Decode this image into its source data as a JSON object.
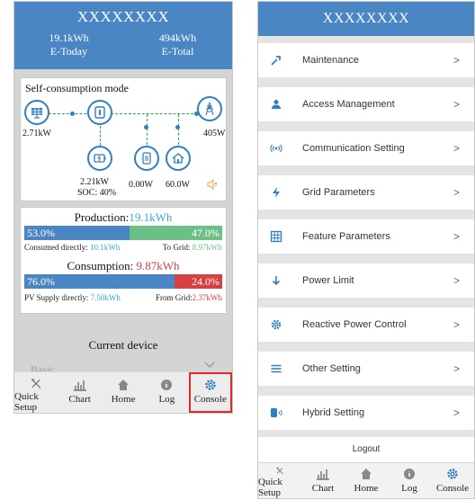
{
  "left": {
    "title": "XXXXXXXX",
    "today_value": "19.1kWh",
    "today_label": "E-Today",
    "total_value": "494kWh",
    "total_label": "E-Total",
    "mode": "Self-consumption mode",
    "pv_power": "2.71kW",
    "grid_power": "405W",
    "battery_power": "2.21kW",
    "battery_soc": "SOC: 40%",
    "meter_power": "0.00W",
    "load_power": "60.0W",
    "production": {
      "title": "Production:",
      "value": "19.1kWh",
      "left_pct": "53.0%",
      "right_pct": "47.0%",
      "left_fraction": 0.53,
      "consumed_label": "Consumed directly:",
      "consumed_value": "10.1kWh",
      "togrid_label": "To Grid:",
      "togrid_value": "8.97kWh"
    },
    "consumption": {
      "title": "Consumption:",
      "value": "9.87kWh",
      "left_pct": "76.0%",
      "right_pct": "24.0%",
      "left_fraction": 0.76,
      "pv_label": "PV Supply directly:",
      "pv_value": "7.50kWh",
      "grid_label": "From Grid:",
      "grid_value": "2.37kWh"
    },
    "current_device": "Current device",
    "basic": "Basic"
  },
  "tabs": [
    "Quick Setup",
    "Chart",
    "Home",
    "Log",
    "Console"
  ],
  "right": {
    "title": "XXXXXXXX",
    "menu": [
      {
        "label": "Maintenance",
        "icon": "wrench-icon"
      },
      {
        "label": "Access Management",
        "icon": "user-icon"
      },
      {
        "label": "Communication Setting",
        "icon": "signal-icon"
      },
      {
        "label": "Grid Parameters",
        "icon": "lightning-icon"
      },
      {
        "label": "Feature Parameters",
        "icon": "grid-icon"
      },
      {
        "label": "Power Limit",
        "icon": "arrow-down-icon"
      },
      {
        "label": "Reactive Power Control",
        "icon": "gear-icon"
      },
      {
        "label": "Other Setting",
        "icon": "list-icon"
      },
      {
        "label": "Hybrid Setting",
        "icon": "battery-icon"
      }
    ],
    "chevron": ">",
    "logout": "Logout"
  },
  "colors": {
    "brand_blue": "#4a86c4",
    "green": "#6cbf86",
    "red": "#d74040",
    "highlight": "#e02a2a"
  }
}
